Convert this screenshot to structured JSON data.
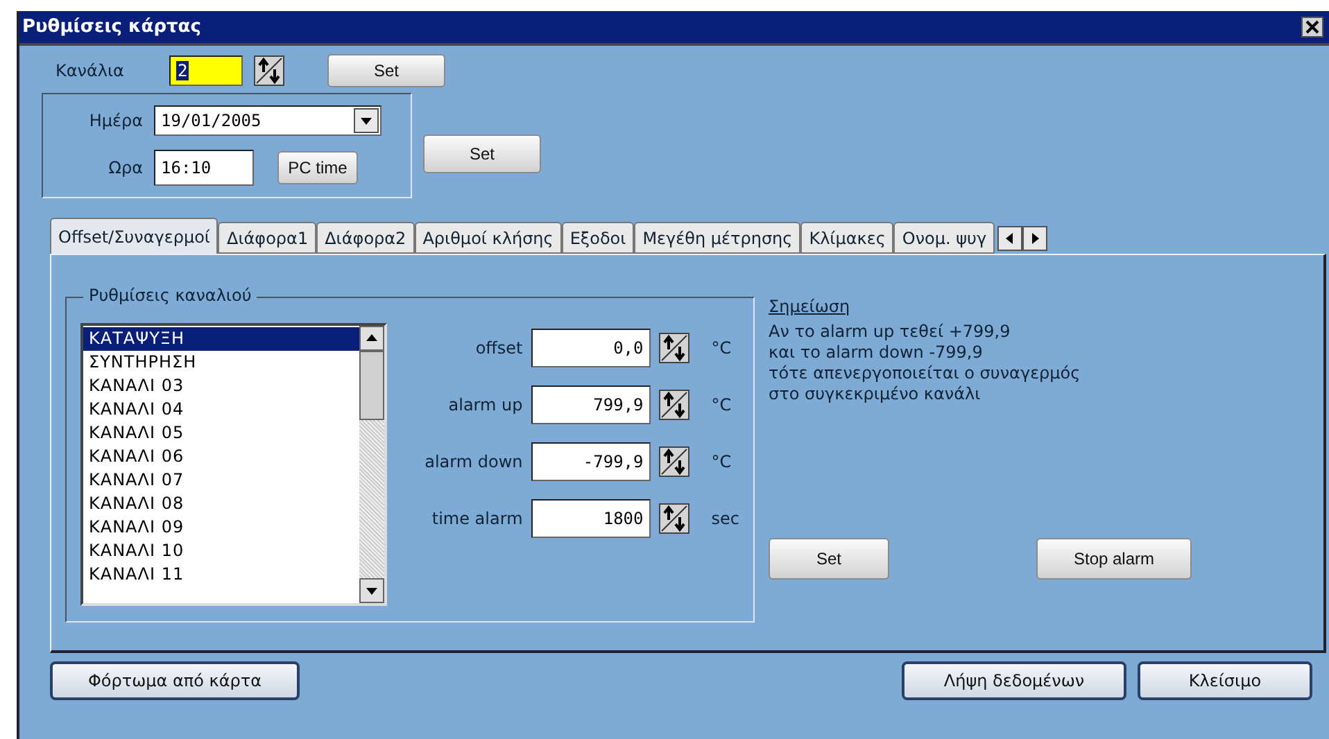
{
  "window": {
    "title": "Ρυθμίσεις κάρτας"
  },
  "channel_count": {
    "label": "Κανάλια",
    "value": "2",
    "set_button": "Set"
  },
  "date_time": {
    "date_label": "Ημέρα",
    "date": "19/01/2005",
    "time_label": "Ωρα",
    "time": "16:10",
    "pc_time_button": "PC time",
    "set_button": "Set"
  },
  "tabs": [
    {
      "label": "Offset/Συναγερμοί",
      "selected": true
    },
    {
      "label": "Διάφορα1",
      "selected": false
    },
    {
      "label": "Διάφορα2",
      "selected": false
    },
    {
      "label": "Αριθμοί κλήσης",
      "selected": false
    },
    {
      "label": "Εξοδοι",
      "selected": false
    },
    {
      "label": "Μεγέθη μέτρησης",
      "selected": false
    },
    {
      "label": "Κλίμακες",
      "selected": false
    },
    {
      "label": "Ονομ. ψυγ",
      "selected": false
    }
  ],
  "channel_settings": {
    "title": "Ρυθμίσεις καναλιού",
    "items": [
      {
        "label": "ΚΑΤΑΨΥΞΗ",
        "selected": true
      },
      {
        "label": "ΣΥΝΤΗΡΗΣΗ",
        "selected": false
      },
      {
        "label": "ΚΑΝΑΛΙ 03",
        "selected": false
      },
      {
        "label": "ΚΑΝΑΛΙ 04",
        "selected": false
      },
      {
        "label": "ΚΑΝΑΛΙ 05",
        "selected": false
      },
      {
        "label": "ΚΑΝΑΛΙ 06",
        "selected": false
      },
      {
        "label": "ΚΑΝΑΛΙ 07",
        "selected": false
      },
      {
        "label": "ΚΑΝΑΛΙ 08",
        "selected": false
      },
      {
        "label": "ΚΑΝΑΛΙ 09",
        "selected": false
      },
      {
        "label": "ΚΑΝΑΛΙ 10",
        "selected": false
      },
      {
        "label": "ΚΑΝΑΛΙ 11",
        "selected": false
      }
    ],
    "fields": [
      {
        "label": "offset",
        "value": "0,0",
        "unit": "°C"
      },
      {
        "label": "alarm up",
        "value": "799,9",
        "unit": "°C"
      },
      {
        "label": "alarm down",
        "value": "-799,9",
        "unit": "°C"
      },
      {
        "label": "time alarm",
        "value": "1800",
        "unit": "sec"
      }
    ]
  },
  "note": {
    "title": "Σημείωση",
    "text": "Αν το alarm up τεθεί +799,9\nκαι το alarm down -799,9\nτότε απενεργοποιείται ο συναγερμός\nστο συγκεκριμένο κανάλι"
  },
  "set_button": "Set",
  "stop_alarm_button": "Stop alarm",
  "footer": {
    "load_button": "Φόρτωμα από κάρτα",
    "fetch_button": "Λήψη δεδομένων",
    "close_button": "Κλείσιμο"
  }
}
